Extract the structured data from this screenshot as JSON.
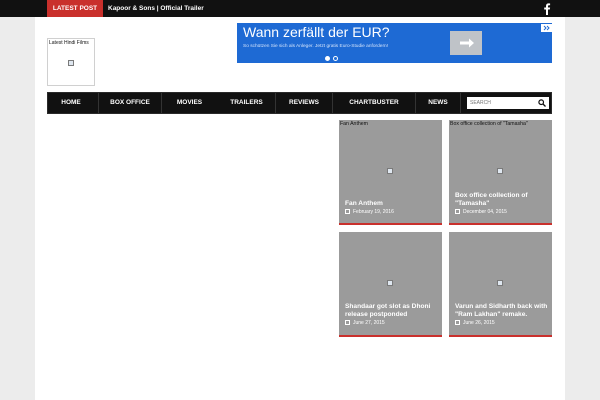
{
  "topbar": {
    "latest_badge": "LATEST POST",
    "latest_title": "Kapoor & Sons | Official Trailer",
    "social_icon": "facebook-icon"
  },
  "logo": {
    "alt_text": "Latest Hindi Films"
  },
  "ad": {
    "headline": "Wann zerfällt der EUR?",
    "subtext": "So schützen Sie sich als Anleger. Jetzt gratis Euro-Studie anfordern!",
    "cta_icon": "arrow-right-icon",
    "slide_count": 2,
    "active_slide": 1,
    "colors": {
      "background": "#1e6ad4",
      "button": "#bfc3c8"
    }
  },
  "nav": {
    "items": [
      {
        "label": "HOME"
      },
      {
        "label": "BOX OFFICE"
      },
      {
        "label": "MOVIES"
      },
      {
        "label": "TRAILERS"
      },
      {
        "label": "REVIEWS"
      },
      {
        "label": "CHARTBUSTER"
      },
      {
        "label": "NEWS"
      }
    ],
    "search_placeholder": "SEARCH",
    "search_icon": "search-icon"
  },
  "posts": [
    {
      "caption": "Fan Anthem",
      "title": "Fan Anthem",
      "date": "February 19, 2016"
    },
    {
      "caption": "Box office collection of \"Tamasha\"",
      "title": "Box office collection of \"Tamasha\"",
      "date": "December 04, 2015"
    },
    {
      "caption": "",
      "title": "Shandaar got slot as Dhoni release postponded",
      "date": "June 27, 2015"
    },
    {
      "caption": "",
      "title": "Varun and Sidharth back with \"Ram Lakhan\" remake.",
      "date": "June 26, 2015"
    }
  ],
  "colors": {
    "accent": "#c9302c",
    "nav_background": "#111111",
    "card_background": "#9b9b9b"
  }
}
